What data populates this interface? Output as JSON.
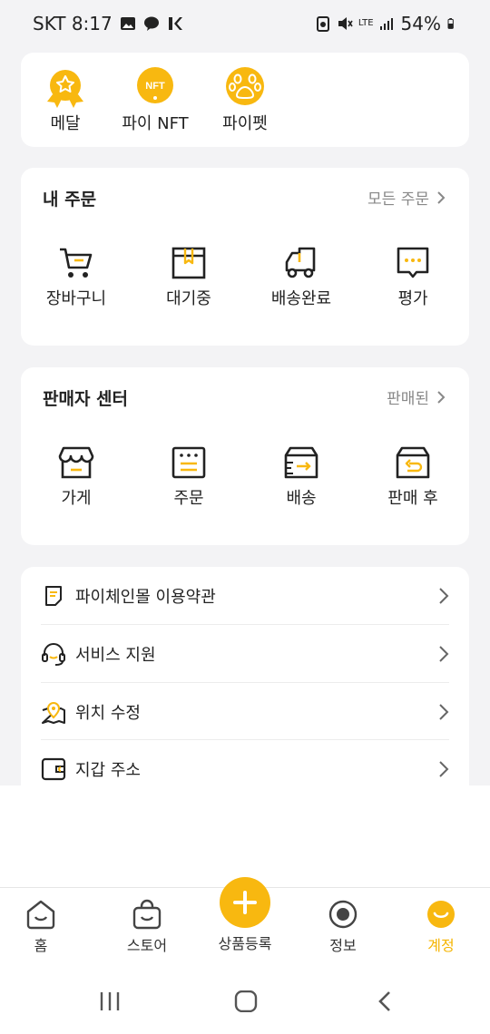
{
  "status_bar": {
    "carrier_time": "SKT 8:17",
    "network": "LTE",
    "battery": "54%"
  },
  "badges": [
    {
      "label": "메달",
      "icon": "medal-icon"
    },
    {
      "label": "파이 NFT",
      "icon": "nft-icon",
      "icon_text": "NFT"
    },
    {
      "label": "파이펫",
      "icon": "paw-icon"
    }
  ],
  "orders": {
    "title": "내 주문",
    "link": "모든 주문",
    "items": [
      {
        "label": "장바구니",
        "icon": "cart-icon"
      },
      {
        "label": "대기중",
        "icon": "box-icon"
      },
      {
        "label": "배송완료",
        "icon": "truck-icon"
      },
      {
        "label": "평가",
        "icon": "chat-icon"
      }
    ]
  },
  "seller": {
    "title": "판매자 센터",
    "link": "판매된",
    "items": [
      {
        "label": "가게",
        "icon": "store-icon"
      },
      {
        "label": "주문",
        "icon": "order-list-icon"
      },
      {
        "label": "배송",
        "icon": "shipping-box-icon"
      },
      {
        "label": "판매 후",
        "icon": "return-box-icon"
      }
    ]
  },
  "menu": [
    {
      "label": "파이체인몰 이용약관",
      "icon": "document-icon"
    },
    {
      "label": "서비스 지원",
      "icon": "headset-icon"
    },
    {
      "label": "위치 수정",
      "icon": "map-pin-icon"
    },
    {
      "label": "지갑 주소",
      "icon": "wallet-icon"
    }
  ],
  "bottom_nav": {
    "home": "홈",
    "store": "스토어",
    "add": "상품등록",
    "info": "정보",
    "account": "계정"
  },
  "colors": {
    "accent": "#f8b810",
    "background": "#f3f3f5"
  }
}
